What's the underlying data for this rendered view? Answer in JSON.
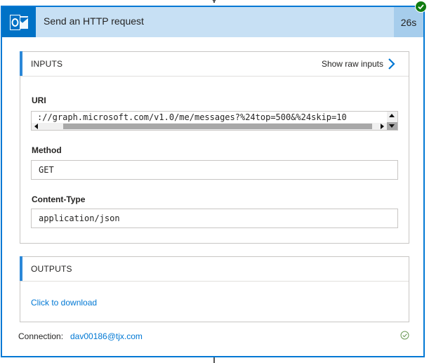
{
  "action": {
    "title": "Send an HTTP request",
    "duration": "26s",
    "icon": "outlook-icon",
    "status": "succeeded",
    "status_icon": "check-icon"
  },
  "inputs": {
    "title": "INPUTS",
    "show_raw_label": "Show raw inputs",
    "fields": {
      "uri": {
        "label": "URI",
        "value": "://graph.microsoft.com/v1.0/me/messages?%24top=500&%24skip=10"
      },
      "method": {
        "label": "Method",
        "value": "GET"
      },
      "content_type": {
        "label": "Content-Type",
        "value": "application/json"
      }
    }
  },
  "outputs": {
    "title": "OUTPUTS",
    "download_label": "Click to download"
  },
  "connection": {
    "label": "Connection:",
    "value": "dav00186@tjx.com",
    "status_icon": "check-circle-icon"
  },
  "colors": {
    "accent": "#0078d4",
    "header_bg": "#c7e0f4",
    "duration_bg": "#a6cdec",
    "success": "#107c10",
    "outlook": "#0072c6"
  }
}
